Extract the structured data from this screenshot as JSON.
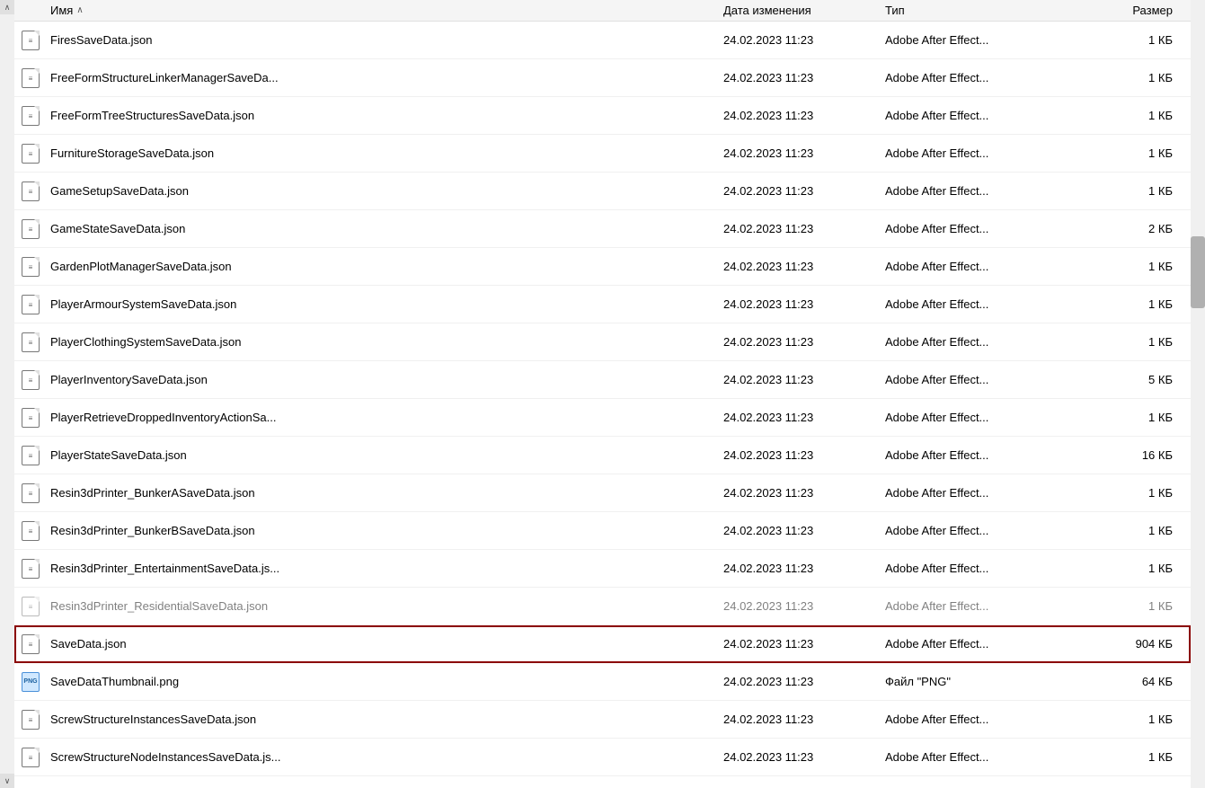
{
  "columns": {
    "name": "Имя",
    "date": "Дата изменения",
    "type": "Тип",
    "size": "Размер"
  },
  "files": [
    {
      "icon": "json",
      "name": "FiresSaveData.json",
      "date": "24.02.2023 11:23",
      "type": "Adobe After Effect...",
      "size": "1 КБ",
      "selected": false
    },
    {
      "icon": "json",
      "name": "FreeFormStructureLinkerManagerSaveDa...",
      "date": "24.02.2023 11:23",
      "type": "Adobe After Effect...",
      "size": "1 КБ",
      "selected": false
    },
    {
      "icon": "json",
      "name": "FreeFormTreeStructuresSaveData.json",
      "date": "24.02.2023 11:23",
      "type": "Adobe After Effect...",
      "size": "1 КБ",
      "selected": false
    },
    {
      "icon": "json",
      "name": "FurnitureStorageSaveData.json",
      "date": "24.02.2023 11:23",
      "type": "Adobe After Effect...",
      "size": "1 КБ",
      "selected": false
    },
    {
      "icon": "json",
      "name": "GameSetupSaveData.json",
      "date": "24.02.2023 11:23",
      "type": "Adobe After Effect...",
      "size": "1 КБ",
      "selected": false
    },
    {
      "icon": "json",
      "name": "GameStateSaveData.json",
      "date": "24.02.2023 11:23",
      "type": "Adobe After Effect...",
      "size": "2 КБ",
      "selected": false
    },
    {
      "icon": "json",
      "name": "GardenPlotManagerSaveData.json",
      "date": "24.02.2023 11:23",
      "type": "Adobe After Effect...",
      "size": "1 КБ",
      "selected": false
    },
    {
      "icon": "json",
      "name": "PlayerArmourSystemSaveData.json",
      "date": "24.02.2023 11:23",
      "type": "Adobe After Effect...",
      "size": "1 КБ",
      "selected": false
    },
    {
      "icon": "json",
      "name": "PlayerClothingSystemSaveData.json",
      "date": "24.02.2023 11:23",
      "type": "Adobe After Effect...",
      "size": "1 КБ",
      "selected": false
    },
    {
      "icon": "json",
      "name": "PlayerInventorySaveData.json",
      "date": "24.02.2023 11:23",
      "type": "Adobe After Effect...",
      "size": "5 КБ",
      "selected": false
    },
    {
      "icon": "json",
      "name": "PlayerRetrieveDroppedInventoryActionSa...",
      "date": "24.02.2023 11:23",
      "type": "Adobe After Effect...",
      "size": "1 КБ",
      "selected": false
    },
    {
      "icon": "json",
      "name": "PlayerStateSaveData.json",
      "date": "24.02.2023 11:23",
      "type": "Adobe After Effect...",
      "size": "16 КБ",
      "selected": false
    },
    {
      "icon": "json",
      "name": "Resin3dPrinter_BunkerASaveData.json",
      "date": "24.02.2023 11:23",
      "type": "Adobe After Effect...",
      "size": "1 КБ",
      "selected": false
    },
    {
      "icon": "json",
      "name": "Resin3dPrinter_BunkerBSaveData.json",
      "date": "24.02.2023 11:23",
      "type": "Adobe After Effect...",
      "size": "1 КБ",
      "selected": false
    },
    {
      "icon": "json",
      "name": "Resin3dPrinter_EntertainmentSaveData.js...",
      "date": "24.02.2023 11:23",
      "type": "Adobe After Effect...",
      "size": "1 КБ",
      "selected": false
    },
    {
      "icon": "json",
      "name": "Resin3dPrinter_ResidentialSaveData.json",
      "date": "24.02.2023 11:23",
      "type": "Adobe After Effect...",
      "size": "1 КБ",
      "selected": false,
      "faded": true
    },
    {
      "icon": "json",
      "name": "SaveData.json",
      "date": "24.02.2023 11:23",
      "type": "Adobe After Effect...",
      "size": "904 КБ",
      "selected": true
    },
    {
      "icon": "png",
      "name": "SaveDataThumbnail.png",
      "date": "24.02.2023 11:23",
      "type": "Файл \"PNG\"",
      "size": "64 КБ",
      "selected": false
    },
    {
      "icon": "json",
      "name": "ScrewStructureInstancesSaveData.json",
      "date": "24.02.2023 11:23",
      "type": "Adobe After Effect...",
      "size": "1 КБ",
      "selected": false
    },
    {
      "icon": "json",
      "name": "ScrewStructureNodeInstancesSaveData.js...",
      "date": "24.02.2023 11:23",
      "type": "Adobe After Effect...",
      "size": "1 КБ",
      "selected": false
    }
  ],
  "icons": {
    "json_lines": "≡",
    "png_image": "▪",
    "sort_up": "∧"
  }
}
